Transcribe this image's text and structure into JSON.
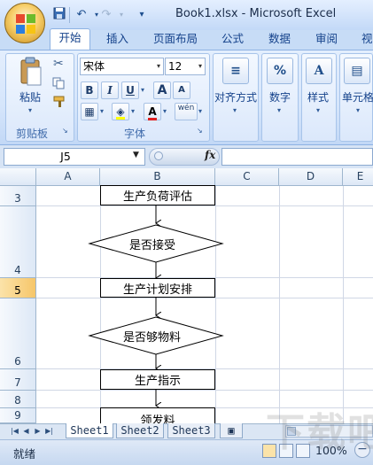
{
  "window": {
    "title": "Book1.xlsx - Microsoft Excel"
  },
  "qat": {
    "undo_icon": "undo-icon",
    "redo_icon": "redo-icon",
    "more": "▾"
  },
  "tabs": [
    "开始",
    "插入",
    "页面布局",
    "公式",
    "数据",
    "审阅",
    "视"
  ],
  "ribbon": {
    "clipboard": {
      "paste": "粘贴",
      "label": "剪贴板"
    },
    "font": {
      "name": "宋体",
      "size": "12",
      "bold": "B",
      "italic": "I",
      "underline": "U",
      "grow": "A",
      "shrink": "A",
      "font_color": "A",
      "phonetic": "wén",
      "label": "字体"
    },
    "align": {
      "label": "对齐方式"
    },
    "number": {
      "label": "数字",
      "icon": "%"
    },
    "styles": {
      "label": "样式"
    },
    "cells": {
      "label": "单元格"
    }
  },
  "formula_bar": {
    "name_box": "J5",
    "fx": "fx",
    "formula": ""
  },
  "sheet": {
    "columns": [
      "A",
      "B",
      "C",
      "D",
      "E"
    ],
    "rows": [
      "3",
      "4",
      "5",
      "6",
      "7",
      "8",
      "9"
    ],
    "active_row": "5",
    "flow": {
      "box1": "生产负荷评估",
      "diamond1": "是否接受",
      "box2": "生产计划安排",
      "diamond2": "是否够物料",
      "box3": "生产指示",
      "box4": "领发料"
    }
  },
  "sheet_tabs": [
    "Sheet1",
    "Sheet2",
    "Sheet3"
  ],
  "status": {
    "text": "就绪",
    "zoom": "100%"
  },
  "watermark": "下载吧"
}
